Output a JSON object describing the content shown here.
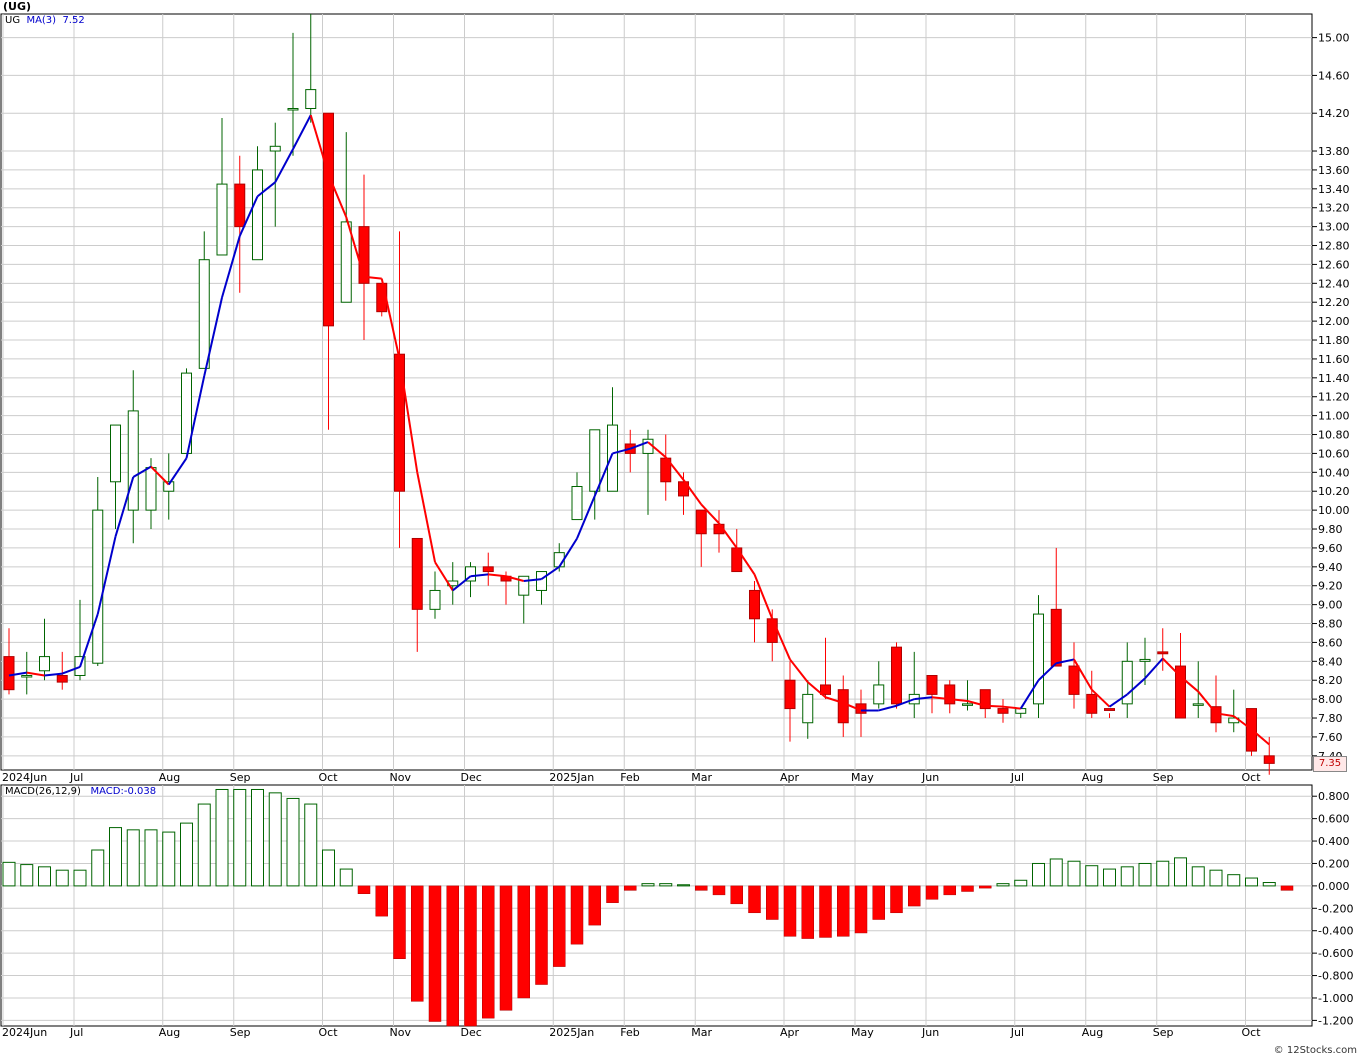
{
  "header": {
    "title": "(UG)",
    "legend_symbol": "UG",
    "legend_ma_label": "MA(3)",
    "legend_ma_value": "7.52",
    "macd_label": "MACD(26,12,9)",
    "macd_value_label": "MACD:-0.038",
    "last_price": "7.35",
    "credit": "© 12Stocks.com"
  },
  "colors": {
    "up": "#006400",
    "down": "#ff0000",
    "ma_up": "#0000cc",
    "ma_down": "#ff0000",
    "grid": "#cccccc"
  },
  "chart_data": [
    {
      "type": "candlestick",
      "title": "(UG)",
      "frequency": "weekly",
      "ylim": [
        7.25,
        15.25
      ],
      "yticks": [
        7.4,
        7.6,
        7.8,
        8.0,
        8.2,
        8.4,
        8.6,
        8.8,
        9.0,
        9.2,
        9.4,
        9.6,
        9.8,
        10.0,
        10.2,
        10.4,
        10.6,
        10.8,
        11.0,
        11.2,
        11.4,
        11.6,
        11.8,
        12.0,
        12.2,
        12.4,
        12.6,
        12.8,
        13.0,
        13.2,
        13.4,
        13.6,
        13.8,
        14.2,
        14.6,
        15.0
      ],
      "xtick_labels": [
        {
          "label": "2024Jun",
          "index": 0
        },
        {
          "label": "Jul",
          "index": 4
        },
        {
          "label": "Aug",
          "index": 9
        },
        {
          "label": "Sep",
          "index": 13
        },
        {
          "label": "Oct",
          "index": 18
        },
        {
          "label": "Nov",
          "index": 22
        },
        {
          "label": "Dec",
          "index": 26
        },
        {
          "label": "2025Jan",
          "index": 31
        },
        {
          "label": "Feb",
          "index": 35
        },
        {
          "label": "Mar",
          "index": 39
        },
        {
          "label": "Apr",
          "index": 44
        },
        {
          "label": "May",
          "index": 48
        },
        {
          "label": "Jun",
          "index": 52
        },
        {
          "label": "Jul",
          "index": 57
        },
        {
          "label": "Aug",
          "index": 61
        },
        {
          "label": "Sep",
          "index": 65
        },
        {
          "label": "Oct",
          "index": 70
        }
      ],
      "ohlc": [
        [
          8.45,
          8.75,
          8.05,
          8.1
        ],
        [
          8.25,
          8.5,
          8.05,
          8.25
        ],
        [
          8.3,
          8.85,
          8.2,
          8.45
        ],
        [
          8.25,
          8.5,
          8.1,
          8.18
        ],
        [
          8.25,
          9.05,
          8.2,
          8.45
        ],
        [
          8.38,
          10.35,
          8.35,
          10.0
        ],
        [
          10.3,
          10.9,
          9.8,
          10.9
        ],
        [
          10.0,
          11.48,
          9.65,
          11.05
        ],
        [
          10.0,
          10.55,
          9.8,
          10.45
        ],
        [
          10.2,
          10.6,
          9.9,
          10.3
        ],
        [
          10.6,
          11.5,
          10.6,
          11.45
        ],
        [
          11.5,
          12.95,
          11.5,
          12.65
        ],
        [
          12.7,
          14.15,
          12.7,
          13.45
        ],
        [
          13.45,
          13.75,
          12.3,
          13.0
        ],
        [
          12.65,
          13.85,
          12.65,
          13.6
        ],
        [
          13.8,
          14.1,
          13.0,
          13.85
        ],
        [
          14.25,
          15.05,
          13.75,
          14.25
        ],
        [
          14.25,
          15.25,
          14.1,
          14.45
        ],
        [
          14.2,
          14.2,
          10.85,
          11.95
        ],
        [
          12.2,
          14.0,
          12.2,
          13.05
        ],
        [
          13.0,
          13.55,
          11.8,
          12.4
        ],
        [
          12.4,
          12.35,
          12.05,
          12.1
        ],
        [
          11.65,
          12.95,
          9.6,
          10.2
        ],
        [
          9.7,
          9.7,
          8.5,
          8.95
        ],
        [
          8.95,
          9.35,
          8.85,
          9.15
        ],
        [
          9.2,
          9.45,
          9.0,
          9.25
        ],
        [
          9.25,
          9.45,
          9.08,
          9.4
        ],
        [
          9.4,
          9.55,
          9.2,
          9.35
        ],
        [
          9.3,
          9.35,
          9.0,
          9.25
        ],
        [
          9.1,
          9.3,
          8.8,
          9.3
        ],
        [
          9.15,
          9.35,
          9.0,
          9.35
        ],
        [
          9.4,
          9.65,
          9.35,
          9.55
        ],
        [
          9.9,
          10.4,
          9.9,
          10.25
        ],
        [
          10.2,
          10.35,
          9.9,
          10.85
        ],
        [
          10.2,
          11.3,
          10.2,
          10.9
        ],
        [
          10.7,
          10.85,
          10.4,
          10.6
        ],
        [
          10.6,
          10.85,
          9.95,
          10.75
        ],
        [
          10.55,
          10.8,
          10.1,
          10.3
        ],
        [
          10.3,
          10.4,
          9.95,
          10.15
        ],
        [
          10.0,
          10.0,
          9.4,
          9.75
        ],
        [
          9.85,
          10.0,
          9.55,
          9.75
        ],
        [
          9.6,
          9.8,
          9.35,
          9.35
        ],
        [
          9.15,
          9.25,
          8.6,
          8.85
        ],
        [
          8.85,
          8.95,
          8.4,
          8.6
        ],
        [
          8.2,
          8.4,
          7.55,
          7.9
        ],
        [
          7.75,
          8.2,
          7.58,
          8.05
        ],
        [
          8.15,
          8.65,
          8.0,
          8.05
        ],
        [
          8.1,
          8.25,
          7.6,
          7.75
        ],
        [
          7.95,
          8.1,
          7.6,
          7.85
        ],
        [
          7.95,
          8.4,
          7.9,
          8.15
        ],
        [
          8.55,
          8.6,
          7.9,
          7.95
        ],
        [
          7.95,
          8.5,
          7.8,
          8.05
        ],
        [
          8.25,
          8.25,
          7.85,
          8.05
        ],
        [
          8.15,
          8.2,
          7.85,
          7.95
        ],
        [
          7.95,
          8.2,
          7.88,
          7.95
        ],
        [
          8.1,
          8.1,
          7.8,
          7.9
        ],
        [
          7.9,
          8.0,
          7.75,
          7.85
        ],
        [
          7.85,
          7.85,
          7.8,
          7.9
        ],
        [
          7.95,
          9.1,
          7.8,
          8.9
        ],
        [
          8.95,
          9.6,
          8.35,
          8.35
        ],
        [
          8.35,
          8.6,
          7.9,
          8.05
        ],
        [
          8.05,
          8.3,
          7.8,
          7.85
        ],
        [
          7.9,
          7.85,
          7.8,
          7.88
        ],
        [
          7.95,
          8.6,
          7.8,
          8.4
        ],
        [
          8.4,
          8.65,
          8.15,
          8.42
        ],
        [
          8.5,
          8.75,
          8.3,
          8.48
        ],
        [
          8.35,
          8.7,
          7.85,
          7.8
        ],
        [
          7.95,
          8.4,
          7.8,
          7.95
        ],
        [
          7.92,
          8.25,
          7.65,
          7.75
        ],
        [
          7.75,
          8.1,
          7.65,
          7.8
        ],
        [
          7.9,
          7.9,
          7.4,
          7.45
        ],
        [
          7.4,
          7.6,
          7.2,
          7.32
        ]
      ],
      "ma3": [
        8.25,
        8.28,
        8.25,
        8.27,
        8.34,
        8.9,
        9.72,
        10.35,
        10.46,
        10.27,
        10.55,
        11.42,
        12.25,
        12.9,
        13.32,
        13.47,
        13.82,
        14.18,
        13.55,
        13.1,
        12.47,
        12.45,
        11.6,
        10.4,
        9.45,
        9.15,
        9.3,
        9.32,
        9.3,
        9.25,
        9.27,
        9.4,
        9.7,
        10.15,
        10.6,
        10.65,
        10.72,
        10.56,
        10.32,
        10.06,
        9.86,
        9.6,
        9.32,
        8.85,
        8.42,
        8.18,
        8.02,
        7.96,
        7.88,
        7.88,
        7.93,
        8.0,
        8.02,
        8.0,
        7.98,
        7.93,
        7.92,
        7.9,
        8.2,
        8.38,
        8.42,
        8.1,
        7.92,
        8.05,
        8.22,
        8.43,
        8.24,
        8.08,
        7.85,
        7.82,
        7.68,
        7.52
      ],
      "ma3_colors_up_rule": "blue when rising, red when falling"
    },
    {
      "type": "bar",
      "title": "MACD(26,12,9)",
      "ylim": [
        -1.25,
        0.9
      ],
      "yticks": [
        0.8,
        0.6,
        0.4,
        0.2,
        0.0,
        -0.2,
        -0.4,
        -0.6,
        -0.8,
        -1.0,
        -1.2
      ],
      "values": [
        0.21,
        0.19,
        0.17,
        0.14,
        0.14,
        0.32,
        0.52,
        0.5,
        0.5,
        0.48,
        0.56,
        0.73,
        0.86,
        0.86,
        0.86,
        0.83,
        0.78,
        0.73,
        0.32,
        0.15,
        -0.07,
        -0.27,
        -0.65,
        -1.03,
        -1.21,
        -1.25,
        -1.25,
        -1.18,
        -1.11,
        -1.0,
        -0.88,
        -0.72,
        -0.52,
        -0.35,
        -0.15,
        -0.04,
        0.02,
        0.02,
        0.01,
        -0.04,
        -0.08,
        -0.16,
        -0.24,
        -0.3,
        -0.45,
        -0.47,
        -0.46,
        -0.45,
        -0.42,
        -0.3,
        -0.24,
        -0.18,
        -0.12,
        -0.08,
        -0.05,
        -0.02,
        0.02,
        0.05,
        0.2,
        0.24,
        0.22,
        0.18,
        0.15,
        0.17,
        0.2,
        0.22,
        0.25,
        0.17,
        0.14,
        0.1,
        0.07,
        0.03,
        -0.04
      ]
    }
  ]
}
